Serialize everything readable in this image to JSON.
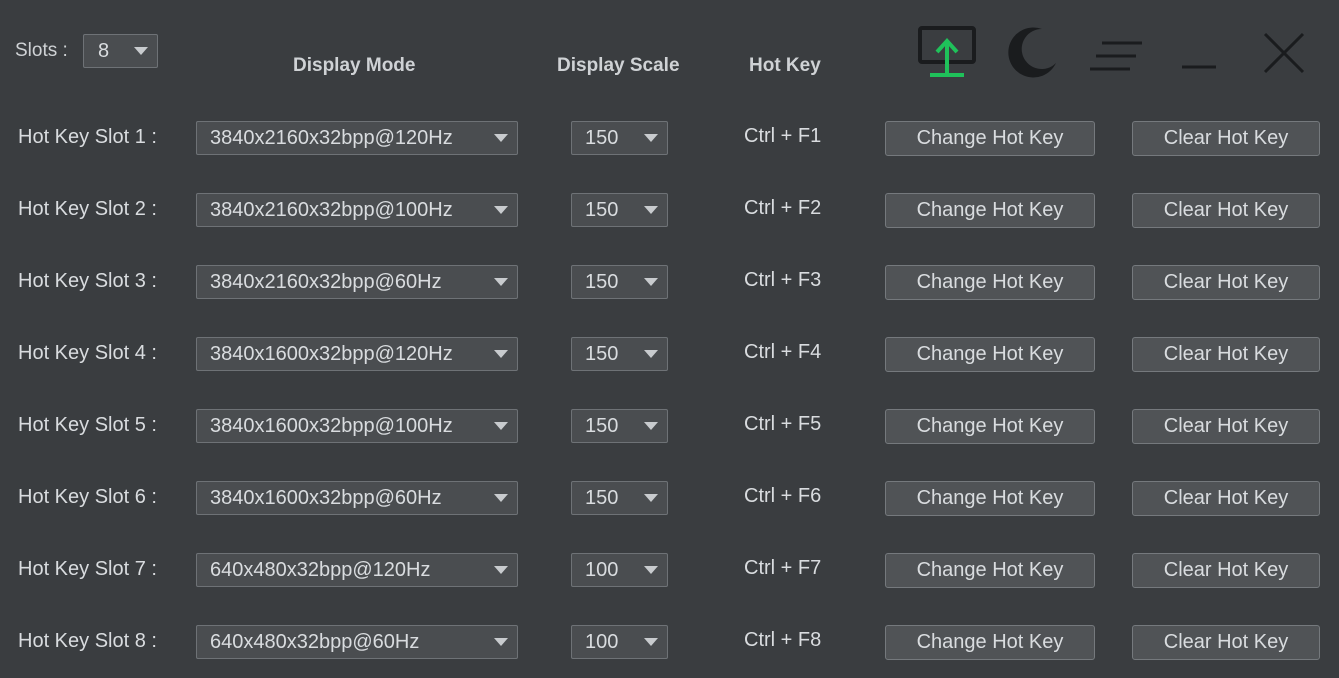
{
  "slots": {
    "label": "Slots :",
    "value": "8"
  },
  "headers": {
    "display_mode": "Display Mode",
    "display_scale": "Display Scale",
    "hot_key": "Hot Key"
  },
  "toolbar": {
    "icons": [
      "upload-display-icon",
      "moon-icon",
      "menu-icon",
      "minimize-icon",
      "close-icon"
    ],
    "accent_color": "#1fc15a"
  },
  "rows": [
    {
      "label": "Hot Key Slot 1 :",
      "mode": "3840x2160x32bpp@120Hz",
      "scale": "150",
      "hotkey": "Ctrl + F1",
      "change": "Change Hot Key",
      "clear": "Clear Hot Key"
    },
    {
      "label": "Hot Key Slot 2 :",
      "mode": "3840x2160x32bpp@100Hz",
      "scale": "150",
      "hotkey": "Ctrl + F2",
      "change": "Change Hot Key",
      "clear": "Clear Hot Key"
    },
    {
      "label": "Hot Key Slot 3 :",
      "mode": "3840x2160x32bpp@60Hz",
      "scale": "150",
      "hotkey": "Ctrl + F3",
      "change": "Change Hot Key",
      "clear": "Clear Hot Key"
    },
    {
      "label": "Hot Key Slot 4 :",
      "mode": "3840x1600x32bpp@120Hz",
      "scale": "150",
      "hotkey": "Ctrl + F4",
      "change": "Change Hot Key",
      "clear": "Clear Hot Key"
    },
    {
      "label": "Hot Key Slot 5 :",
      "mode": "3840x1600x32bpp@100Hz",
      "scale": "150",
      "hotkey": "Ctrl + F5",
      "change": "Change Hot Key",
      "clear": "Clear Hot Key"
    },
    {
      "label": "Hot Key Slot 6 :",
      "mode": "3840x1600x32bpp@60Hz",
      "scale": "150",
      "hotkey": "Ctrl + F6",
      "change": "Change Hot Key",
      "clear": "Clear Hot Key"
    },
    {
      "label": "Hot Key Slot 7 :",
      "mode": "640x480x32bpp@120Hz",
      "scale": "100",
      "hotkey": "Ctrl + F7",
      "change": "Change Hot Key",
      "clear": "Clear Hot Key"
    },
    {
      "label": "Hot Key Slot 8 :",
      "mode": "640x480x32bpp@60Hz",
      "scale": "100",
      "hotkey": "Ctrl + F8",
      "change": "Change Hot Key",
      "clear": "Clear Hot Key"
    }
  ]
}
